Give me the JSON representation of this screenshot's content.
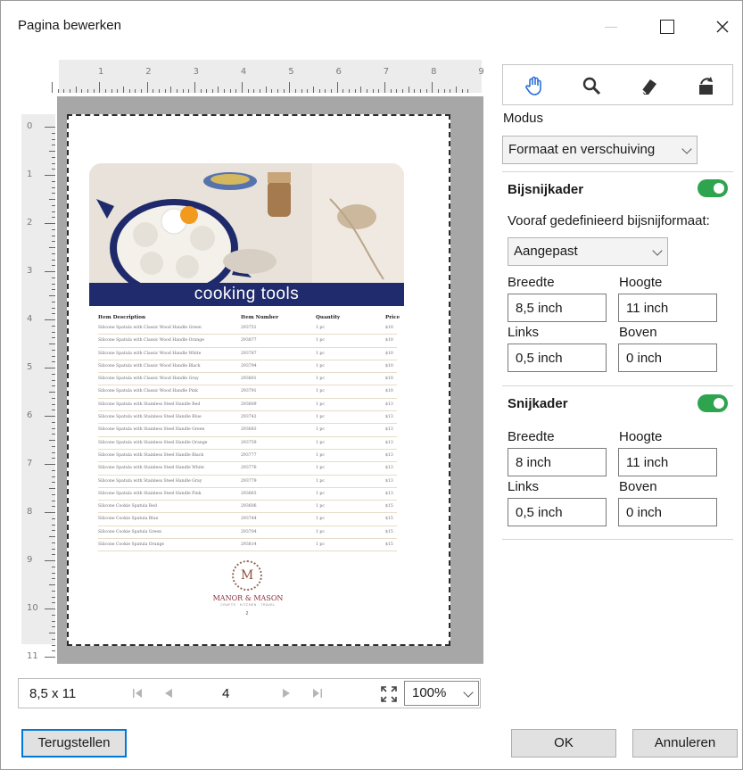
{
  "window": {
    "title": "Pagina bewerken",
    "minimize_icon": "minimize-icon",
    "maximize_icon": "maximize-icon",
    "close_icon": "close-icon"
  },
  "ruler": {
    "top_labels": [
      "1",
      "2",
      "3",
      "4",
      "5",
      "6",
      "7",
      "8",
      "9"
    ],
    "left_labels": [
      "0",
      "1",
      "2",
      "3",
      "4",
      "5",
      "6",
      "7",
      "8",
      "9",
      "10",
      "11"
    ]
  },
  "document": {
    "banner_title": "cooking tools",
    "table_header": [
      "Item Description",
      "Item Number",
      "Quantity",
      "Price"
    ],
    "rows": [
      [
        "Silicone Spatula with Classic Wood Handle Green",
        "293751",
        "1 pc",
        "$10"
      ],
      [
        "Silicone Spatula with Classic Wood Handle Orange",
        "293877",
        "1 pc",
        "$10"
      ],
      [
        "Silicone Spatula with Classic Wood Handle White",
        "293787",
        "1 pc",
        "$10"
      ],
      [
        "Silicone Spatula with Classic Wood Handle Black",
        "293794",
        "1 pc",
        "$10"
      ],
      [
        "Silicone Spatula with Classic Wood Handle Gray",
        "293801",
        "1 pc",
        "$10"
      ],
      [
        "Silicone Spatula with Classic Wood Handle Pink",
        "293791",
        "1 pc",
        "$10"
      ],
      [
        "Silicone Spatula with Stainless Steel Handle Red",
        "293609",
        "1 pc",
        "$13"
      ],
      [
        "Silicone Spatula with Stainless Steel Handle Blue",
        "293742",
        "1 pc",
        "$13"
      ],
      [
        "Silicone Spatula with Stainless Steel Handle Green",
        "293683",
        "1 pc",
        "$13"
      ],
      [
        "Silicone Spatula with Stainless Steel Handle Orange",
        "293759",
        "1 pc",
        "$13"
      ],
      [
        "Silicone Spatula with Stainless Steel Handle Black",
        "293777",
        "1 pc",
        "$13"
      ],
      [
        "Silicone Spatula with Stainless Steel Handle White",
        "293776",
        "1 pc",
        "$13"
      ],
      [
        "Silicone Spatula with Stainless Steel Handle Gray",
        "293779",
        "1 pc",
        "$13"
      ],
      [
        "Silicone Spatula with Stainless Steel Handle Pink",
        "293663",
        "1 pc",
        "$13"
      ],
      [
        "Silicone Cookie Spatula Red",
        "293606",
        "1 pc",
        "$15"
      ],
      [
        "Silicone Cookie Spatula Blue",
        "293744",
        "1 pc",
        "$15"
      ],
      [
        "Silicone Cookie Spatula Green",
        "293704",
        "1 pc",
        "$15"
      ],
      [
        "Silicone Cookie Spatula Orange",
        "293814",
        "1 pc",
        "$15"
      ]
    ],
    "logo_letter": "M",
    "brand": "MANOR & MASON",
    "brand_sub": "CRAFTS · KITCHEN · TRAVEL",
    "page_number": "2"
  },
  "nav": {
    "page_size": "8,5 x 11",
    "current_page": "4",
    "zoom": "100%",
    "first_icon": "first-page-icon",
    "prev_icon": "prev-page-icon",
    "next_icon": "next-page-icon",
    "last_icon": "last-page-icon",
    "fit_icon": "fit-to-window-icon"
  },
  "panel": {
    "tools": [
      "hand-icon",
      "zoom-icon",
      "eraser-icon",
      "rotate-icon"
    ],
    "mode_label": "Modus",
    "mode_value": "Formaat en verschuiving",
    "bleed": {
      "title": "Bijsnijkader",
      "enabled": true,
      "preset_label": "Vooraf gedefinieerd bijsnijformaat:",
      "preset_value": "Aangepast",
      "width_label": "Breedte",
      "width_value": "8,5 inch",
      "height_label": "Hoogte",
      "height_value": "11 inch",
      "left_label": "Links",
      "left_value": "0,5 inch",
      "top_label": "Boven",
      "top_value": "0 inch"
    },
    "trim": {
      "title": "Snijkader",
      "enabled": true,
      "width_label": "Breedte",
      "width_value": "8 inch",
      "height_label": "Hoogte",
      "height_value": "11 inch",
      "left_label": "Links",
      "left_value": "0,5 inch",
      "top_label": "Boven",
      "top_value": "0 inch"
    },
    "toggle_color": "#2ea44f"
  },
  "footer": {
    "reset_label": "Terugstellen",
    "ok_label": "OK",
    "cancel_label": "Annuleren"
  }
}
